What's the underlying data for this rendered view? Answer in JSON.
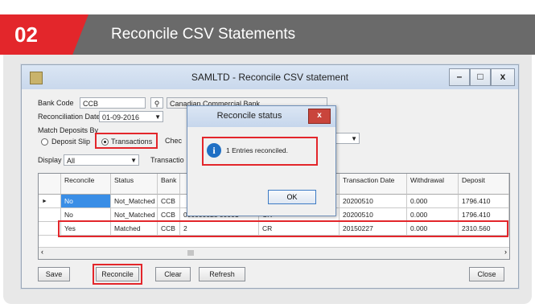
{
  "header": {
    "step": "02",
    "title": "Reconcile CSV Statements"
  },
  "window": {
    "title": "SAMLTD - Reconcile CSV statement",
    "minimize": "–",
    "maximize": "□",
    "close": "x"
  },
  "form": {
    "bank_code_label": "Bank Code",
    "bank_code_value": "CCB",
    "bank_name": "Canadian Commercial Bank",
    "reconciliation_date_label": "Reconciliation Date",
    "reconciliation_date_value": "01-09-2016",
    "match_deposits_label": "Match Deposits By",
    "option_deposit_slip": "Deposit Slip",
    "option_transactions": "Transactions",
    "selected_option": "Transactions",
    "check_label": "Chec",
    "display_label": "Display",
    "display_value": "All",
    "transaction_label": "Transactio"
  },
  "table": {
    "columns": [
      "Reconcile",
      "Status",
      "Bank",
      "Transaction Date",
      "Withdrawal",
      "Deposit"
    ],
    "rows": [
      {
        "reconcile": "No",
        "status": "Not_Matched",
        "bank": "CCB",
        "ref": "",
        "type": "",
        "date": "20200510",
        "withdrawal": "0.000",
        "deposit": "1796.410"
      },
      {
        "reconcile": "No",
        "status": "Not_Matched",
        "bank": "CCB",
        "ref": "000000028 00001",
        "type": "CR",
        "date": "20200510",
        "withdrawal": "0.000",
        "deposit": "1796.410"
      },
      {
        "reconcile": "Yes",
        "status": "Matched",
        "bank": "CCB",
        "ref": "2",
        "type": "CR",
        "date": "20150227",
        "withdrawal": "0.000",
        "deposit": "2310.560"
      }
    ]
  },
  "buttons": {
    "save": "Save",
    "reconcile": "Reconcile",
    "clear": "Clear",
    "refresh": "Refresh",
    "close": "Close"
  },
  "dialog": {
    "title": "Reconcile status",
    "close": "x",
    "message": "1 Entries reconciled.",
    "ok": "OK"
  },
  "colors": {
    "accent": "#e3262b",
    "header_bg": "#6a6a6a",
    "selection": "#3a8ee6"
  }
}
